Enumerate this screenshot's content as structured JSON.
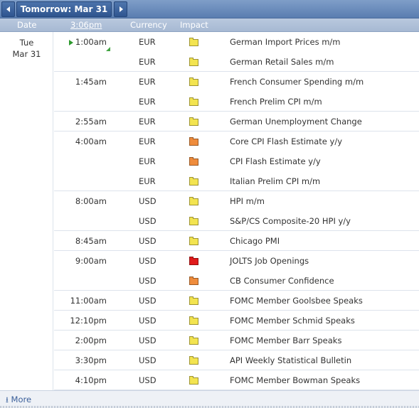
{
  "nav": {
    "title": "Tomorrow: Mar 31",
    "prev_icon": "triangle-left",
    "next_icon": "triangle-right"
  },
  "columns": {
    "date": "Date",
    "time": "3:06pm",
    "currency": "Currency",
    "impact": "Impact"
  },
  "day": {
    "weekday": "Tue",
    "date": "Mar 31"
  },
  "impact_colors": {
    "low": "#f3e450",
    "medium": "#ef8c3c",
    "high": "#e01b1b"
  },
  "events": [
    {
      "time": "1:00am",
      "currency": "EUR",
      "impact": "low",
      "title": "German Import Prices m/m",
      "next": true
    },
    {
      "time": "",
      "currency": "EUR",
      "impact": "low",
      "title": "German Retail Sales m/m"
    },
    {
      "time": "1:45am",
      "currency": "EUR",
      "impact": "low",
      "title": "French Consumer Spending m/m"
    },
    {
      "time": "",
      "currency": "EUR",
      "impact": "low",
      "title": "French Prelim CPI m/m"
    },
    {
      "time": "2:55am",
      "currency": "EUR",
      "impact": "low",
      "title": "German Unemployment Change"
    },
    {
      "time": "4:00am",
      "currency": "EUR",
      "impact": "medium",
      "title": "Core CPI Flash Estimate y/y"
    },
    {
      "time": "",
      "currency": "EUR",
      "impact": "medium",
      "title": "CPI Flash Estimate y/y"
    },
    {
      "time": "",
      "currency": "EUR",
      "impact": "low",
      "title": "Italian Prelim CPI m/m"
    },
    {
      "time": "8:00am",
      "currency": "USD",
      "impact": "low",
      "title": "HPI m/m"
    },
    {
      "time": "",
      "currency": "USD",
      "impact": "low",
      "title": "S&P/CS Composite-20 HPI y/y"
    },
    {
      "time": "8:45am",
      "currency": "USD",
      "impact": "low",
      "title": "Chicago PMI"
    },
    {
      "time": "9:00am",
      "currency": "USD",
      "impact": "high",
      "title": "JOLTS Job Openings"
    },
    {
      "time": "",
      "currency": "USD",
      "impact": "medium",
      "title": "CB Consumer Confidence"
    },
    {
      "time": "11:00am",
      "currency": "USD",
      "impact": "low",
      "title": "FOMC Member Goolsbee Speaks"
    },
    {
      "time": "12:10pm",
      "currency": "USD",
      "impact": "low",
      "title": "FOMC Member Schmid Speaks"
    },
    {
      "time": "2:00pm",
      "currency": "USD",
      "impact": "low",
      "title": "FOMC Member Barr Speaks"
    },
    {
      "time": "3:30pm",
      "currency": "USD",
      "impact": "low",
      "title": "API Weekly Statistical Bulletin"
    },
    {
      "time": "4:10pm",
      "currency": "USD",
      "impact": "low",
      "title": "FOMC Member Bowman Speaks"
    }
  ],
  "footer": {
    "more_label": "More",
    "more_icon": "download-arrow"
  }
}
